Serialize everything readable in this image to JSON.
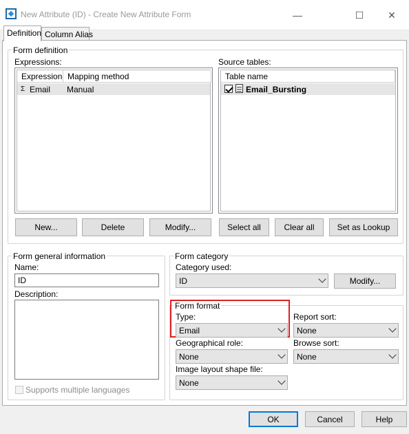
{
  "window": {
    "title": "New Attribute (ID) - Create New Attribute Form",
    "minimize_glyph": "—",
    "maximize_glyph": "☐",
    "close_glyph": "✕"
  },
  "tabs": [
    {
      "label": "Definition",
      "active": true
    },
    {
      "label": "Column Alias",
      "active": false
    }
  ],
  "form_definition": {
    "legend": "Form definition",
    "expressions_label": "Expressions:",
    "expressions_columns": [
      "Expression",
      "Mapping method"
    ],
    "expressions_rows": [
      {
        "expression": "Email",
        "mapping_method": "Manual"
      }
    ],
    "source_tables_label": "Source tables:",
    "source_tables_columns": [
      "Table name"
    ],
    "source_tables_rows": [
      {
        "name": "Email_Bursting",
        "checked": true
      }
    ],
    "buttons": {
      "new": "New...",
      "delete": "Delete",
      "modify": "Modify...",
      "select_all": "Select all",
      "clear_all": "Clear all",
      "set_as_lookup": "Set as Lookup"
    }
  },
  "form_general_information": {
    "legend": "Form general information",
    "name_label": "Name:",
    "name_value": "ID",
    "description_label": "Description:",
    "description_value": "",
    "supports_multiple_languages": "Supports multiple languages"
  },
  "form_category": {
    "legend": "Form category",
    "category_used_label": "Category used:",
    "category_used_value": "ID",
    "modify_button": "Modify..."
  },
  "form_format": {
    "legend": "Form format",
    "type_label": "Type:",
    "type_value": "Email",
    "report_sort_label": "Report sort:",
    "report_sort_value": "None",
    "geographical_role_label": "Geographical role:",
    "geographical_role_value": "None",
    "browse_sort_label": "Browse sort:",
    "browse_sort_value": "None",
    "image_layout_label": "Image layout shape file:",
    "image_layout_value": "None"
  },
  "footer": {
    "ok": "OK",
    "cancel": "Cancel",
    "help": "Help"
  },
  "colors": {
    "highlight": "#e02020",
    "default_button_border": "#0078d7"
  }
}
